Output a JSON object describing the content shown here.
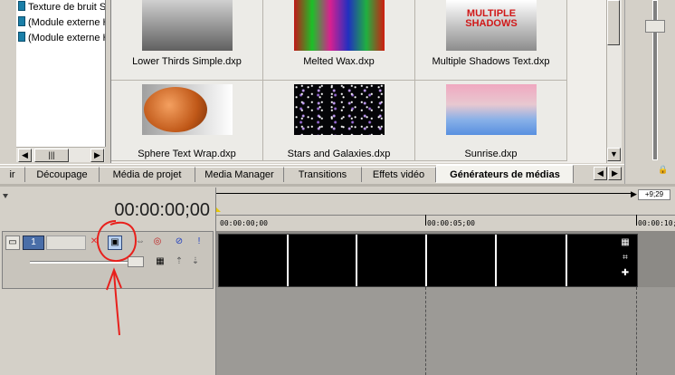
{
  "tree": {
    "items": [
      "Texture de bruit S",
      "(Module externe H",
      "(Module externe H"
    ]
  },
  "media_grid": {
    "items": [
      {
        "label": "Lower Thirds Simple.dxp",
        "thumb": "gray-gradient"
      },
      {
        "label": "Melted Wax.dxp",
        "thumb": "psychedelic"
      },
      {
        "label": "Multiple Shadows Text.dxp",
        "thumb_text": "MULTIPLE SHADOWS"
      },
      {
        "label": "Sphere Text Wrap.dxp",
        "thumb": "orange-sphere"
      },
      {
        "label": "Stars and Galaxies.dxp",
        "thumb": "starfield"
      },
      {
        "label": "Sunrise.dxp",
        "thumb": "sky"
      }
    ]
  },
  "tabs": [
    {
      "label": "ir"
    },
    {
      "label": "Découpage"
    },
    {
      "label": "Média de projet"
    },
    {
      "label": "Media Manager"
    },
    {
      "label": "Transitions"
    },
    {
      "label": "Effets vidéo"
    },
    {
      "label": "Générateurs de médias",
      "active": true
    }
  ],
  "timeline": {
    "timecode": "00:00:00;00",
    "track_number": "1",
    "end_marker": "+9;29",
    "ruler_labels": [
      "00:00:00;00",
      "00:00:05;00",
      "00:00:10;0"
    ]
  },
  "colors": {
    "annotation": "#e8201c",
    "clip": "#000000"
  }
}
